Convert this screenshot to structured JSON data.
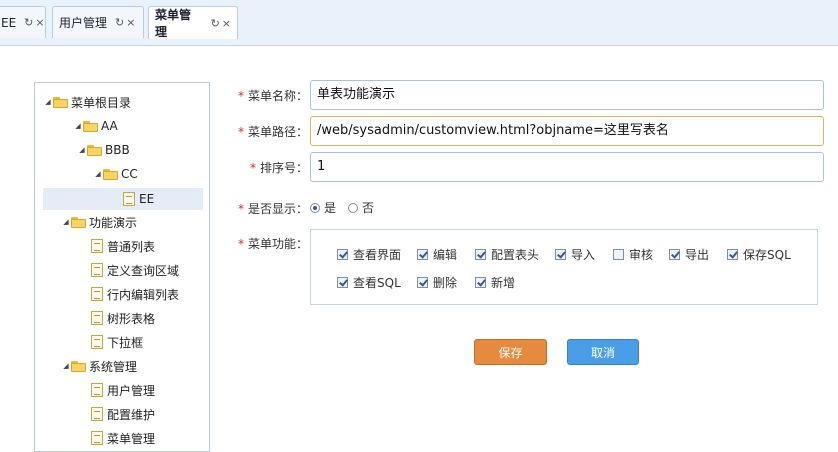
{
  "tabs": [
    {
      "label": "EE",
      "refresh_icon": "↻",
      "close_icon": "×"
    },
    {
      "label": "用户管理",
      "refresh_icon": "↻",
      "close_icon": "×"
    },
    {
      "label": "菜单管理",
      "refresh_icon": "↻",
      "close_icon": "×"
    }
  ],
  "tree": [
    {
      "label": "菜单根目录",
      "type": "folder",
      "expanded": true
    },
    {
      "label": "AA",
      "type": "folder",
      "expanded": true
    },
    {
      "label": "BBB",
      "type": "folder",
      "expanded": true
    },
    {
      "label": "CC",
      "type": "folder",
      "expanded": true
    },
    {
      "label": "EE",
      "type": "file",
      "selected": true
    },
    {
      "label": "功能演示",
      "type": "folder",
      "expanded": true
    },
    {
      "label": "普通列表",
      "type": "file"
    },
    {
      "label": "定义查询区域",
      "type": "file"
    },
    {
      "label": "行内编辑列表",
      "type": "file"
    },
    {
      "label": "树形表格",
      "type": "file"
    },
    {
      "label": "下拉框",
      "type": "file"
    },
    {
      "label": "系统管理",
      "type": "folder",
      "expanded": true
    },
    {
      "label": "用户管理",
      "type": "file"
    },
    {
      "label": "配置维护",
      "type": "file"
    },
    {
      "label": "菜单管理",
      "type": "file"
    }
  ],
  "form": {
    "required_mark": "*",
    "name_label": "菜单名称：",
    "name_value": "单表功能演示",
    "path_label": "菜单路径：",
    "path_value": "/web/sysadmin/customview.html?objname=这里写表名",
    "order_label": "排序号：",
    "order_value": "1",
    "show_label": "是否显示：",
    "show_yes": "是",
    "show_no": "否",
    "func_label": "菜单功能：",
    "functions": [
      {
        "label": "查看界面",
        "checked": true
      },
      {
        "label": "编辑",
        "checked": true
      },
      {
        "label": "配置表头",
        "checked": true
      },
      {
        "label": "导入",
        "checked": true
      },
      {
        "label": "审核",
        "checked": false
      },
      {
        "label": "导出",
        "checked": true
      },
      {
        "label": "保存SQL",
        "checked": true
      },
      {
        "label": "查看SQL",
        "checked": true
      },
      {
        "label": "删除",
        "checked": true
      },
      {
        "label": "新增",
        "checked": true
      }
    ]
  },
  "buttons": {
    "save": "保存",
    "cancel": "取消"
  },
  "colors": {
    "save": "#e58a3e",
    "cancel": "#4a9ee8",
    "required": "#dd2222"
  }
}
